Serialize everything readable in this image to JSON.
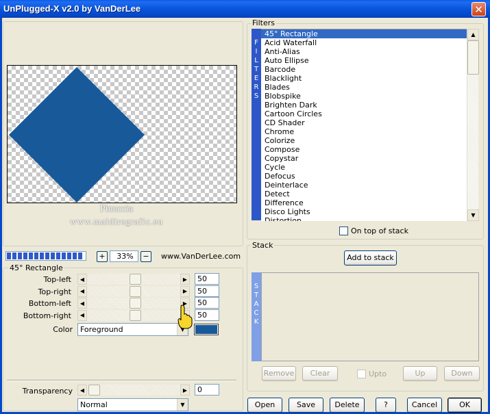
{
  "window": {
    "title": "UnPlugged-X v2.0 by VanDerLee",
    "close_glyph": "✕"
  },
  "preview": {
    "shape_color": "#18599A",
    "watermark_line1": "Pinuccia",
    "watermark_line2": "www.maldiregrafic.eu"
  },
  "toolbar": {
    "zoom_in": "+",
    "zoom_out": "−",
    "zoom_value": "33%",
    "website": "www.VanDerLee.com"
  },
  "params": {
    "group_title": "45° Rectangle",
    "sliders": [
      {
        "label": "Top-left",
        "value": "50"
      },
      {
        "label": "Top-right",
        "value": "50"
      },
      {
        "label": "Bottom-left",
        "value": "50"
      },
      {
        "label": "Bottom-right",
        "value": "50"
      }
    ],
    "color_label": "Color",
    "color_select": "Foreground",
    "color_swatch": "#18599A",
    "transparency_label": "Transparency",
    "transparency_value": "0",
    "blend_select": "Normal"
  },
  "filters": {
    "group_title": "Filters",
    "vertical_label": [
      "F",
      "I",
      "L",
      "T",
      "E",
      "R",
      "S"
    ],
    "items": [
      "45° Rectangle",
      "Acid Waterfall",
      "Anti-Alias",
      "Auto Ellipse",
      "Barcode",
      "Blacklight",
      "Blades",
      "Blobspike",
      "Brighten Dark",
      "Cartoon Circles",
      "CD Shader",
      "Chrome",
      "Colorize",
      "Compose",
      "Copystar",
      "Cycle",
      "Defocus",
      "Deinterlace",
      "Detect",
      "Difference",
      "Disco Lights",
      "Distortion"
    ],
    "selected_index": 0,
    "on_top_label": "On top of stack"
  },
  "stack": {
    "group_title": "Stack",
    "add_label": "Add to stack",
    "vertical_label": [
      "S",
      "T",
      "A",
      "C",
      "K"
    ],
    "remove_label": "Remove",
    "clear_label": "Clear",
    "upto_label": "Upto",
    "up_label": "Up",
    "down_label": "Down"
  },
  "footer": {
    "open_label": "Open",
    "save_label": "Save",
    "delete_label": "Delete",
    "help_label": "?",
    "cancel_label": "Cancel",
    "ok_label": "OK"
  }
}
